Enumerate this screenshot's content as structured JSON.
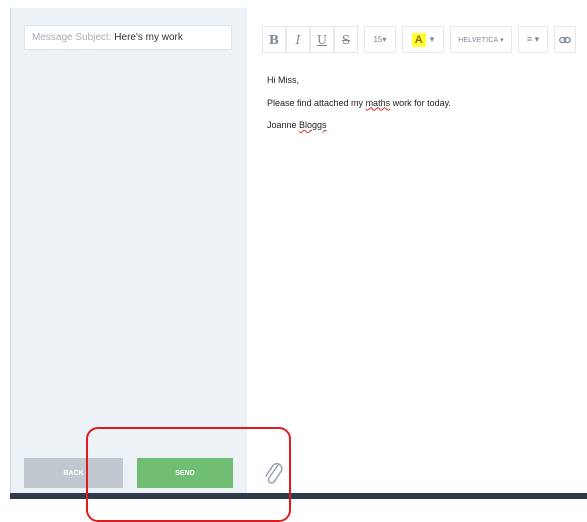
{
  "subject": {
    "label": "Message Subject:",
    "value": "Here's my work"
  },
  "toolbar": {
    "bold": "B",
    "italic": "I",
    "underline": "U",
    "strike": "S",
    "size": "15▾",
    "color_swatch": "A",
    "color_caret": "▾",
    "font": "HELVETICA ▾",
    "align": "≡ ▾",
    "link": "⊂⊃"
  },
  "message": {
    "greeting": "Hi Miss,",
    "line_before": "Please find attached my ",
    "misspelled_word": "maths",
    "line_after": " work for today.",
    "sig_first": "Joanne ",
    "sig_last": "Bloggs"
  },
  "buttons": {
    "back": "BACK",
    "send": "SEND"
  },
  "icons": {
    "attach": "paperclip-icon",
    "link": "link-icon",
    "align": "align-icon"
  },
  "colors": {
    "send": "#6fbe73",
    "back": "#c2c8cf",
    "highlight": "#e01b1b",
    "text_color_swatch": "#ffff33"
  }
}
